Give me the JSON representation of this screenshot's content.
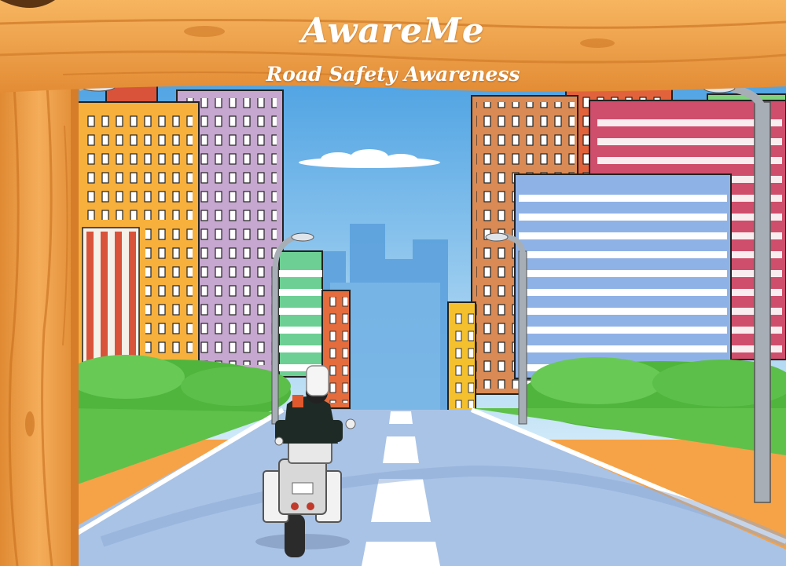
{
  "app": {
    "title": "AwareMe",
    "subtitle": "Road Safety Awareness"
  },
  "colors": {
    "wood": "#f2a24c",
    "wood_dark": "#c8701e",
    "sky": "#64b7ea",
    "road": "#a9c3e6",
    "grass": "#5fc14a",
    "lane_marking": "#ffffff"
  }
}
